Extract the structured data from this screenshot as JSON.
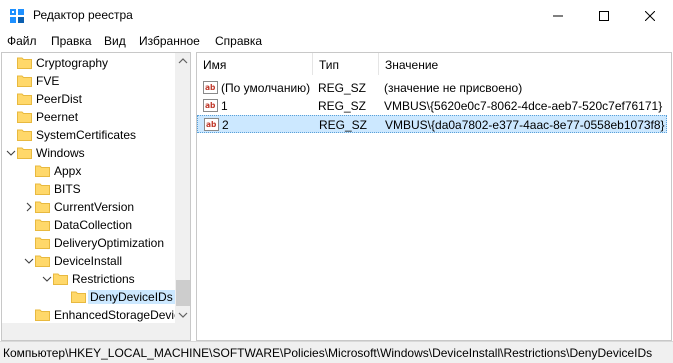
{
  "window": {
    "title": "Редактор реестра"
  },
  "menu": [
    "Файл",
    "Правка",
    "Вид",
    "Избранное",
    "Справка"
  ],
  "tree": [
    {
      "label": "Cryptography",
      "expander": "none"
    },
    {
      "label": "FVE",
      "expander": "none"
    },
    {
      "label": "PeerDist",
      "expander": "none"
    },
    {
      "label": "Peernet",
      "expander": "none"
    },
    {
      "label": "SystemCertificates",
      "expander": "none"
    },
    {
      "label": "Windows",
      "expander": "expanded"
    },
    {
      "label": "Appx",
      "expander": "none"
    },
    {
      "label": "BITS",
      "expander": "none"
    },
    {
      "label": "CurrentVersion",
      "expander": "collapsed"
    },
    {
      "label": "DataCollection",
      "expander": "none"
    },
    {
      "label": "DeliveryOptimization",
      "expander": "none"
    },
    {
      "label": "DeviceInstall",
      "expander": "expanded"
    },
    {
      "label": "Restrictions",
      "expander": "expanded"
    },
    {
      "label": "DenyDeviceIDs",
      "expander": "none",
      "selected": true
    },
    {
      "label": "EnhancedStorageDevic",
      "expander": "none"
    }
  ],
  "columns": {
    "name": "Имя",
    "type": "Тип",
    "value": "Значение"
  },
  "values": [
    {
      "name": "(По умолчанию)",
      "type": "REG_SZ",
      "data": "(значение не присвоено)"
    },
    {
      "name": "1",
      "type": "REG_SZ",
      "data": "VMBUS\\{5620e0c7-8062-4dce-aeb7-520c7ef76171}"
    },
    {
      "name": "2",
      "type": "REG_SZ",
      "data": "VMBUS\\{da0a7802-e377-4aac-8e77-0558eb1073f8}",
      "selected": true
    }
  ],
  "status": {
    "path": "Компьютер\\HKEY_LOCAL_MACHINE\\SOFTWARE\\Policies\\Microsoft\\Windows\\DeviceInstall\\Restrictions\\DenyDeviceIDs"
  },
  "colors": {
    "selection": "#cce8ff",
    "folder": "#ffd86a",
    "folder_dark": "#e8b93f",
    "ab_icon": "#c0392b"
  }
}
